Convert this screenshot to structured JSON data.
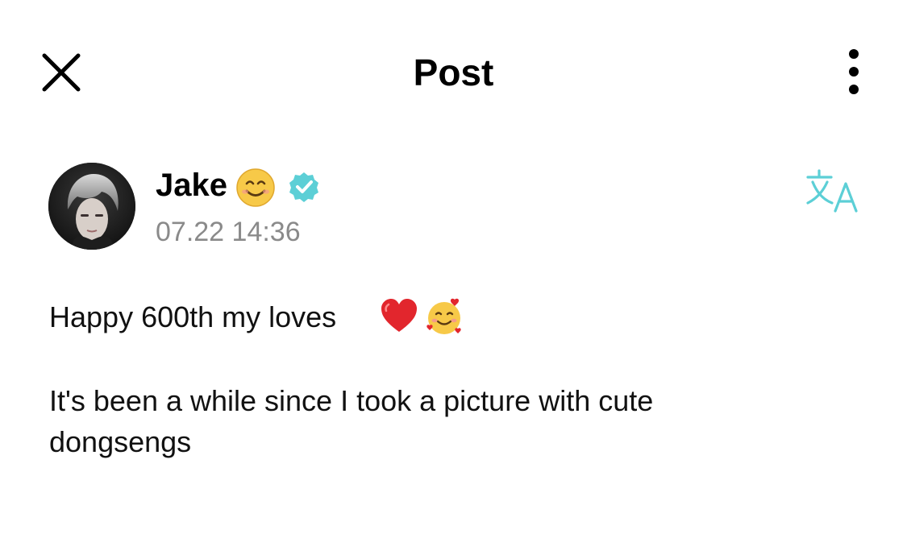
{
  "header": {
    "title": "Post",
    "close_icon": "close-icon",
    "more_icon": "more-vertical-icon"
  },
  "author": {
    "name": "Jake",
    "name_emoji": "smiling-face-emoji",
    "verified_icon": "verified-badge-icon",
    "timestamp": "07.22 14:36",
    "accent_color": "#5ccfd6"
  },
  "translate": {
    "icon": "translate-icon"
  },
  "post": {
    "line1": "Happy 600th my loves",
    "line1_emojis": [
      "red-heart-emoji",
      "smiling-face-with-hearts-emoji"
    ],
    "line2": "It's been a while since I took a picture with cute",
    "line3": "dongsengs"
  }
}
